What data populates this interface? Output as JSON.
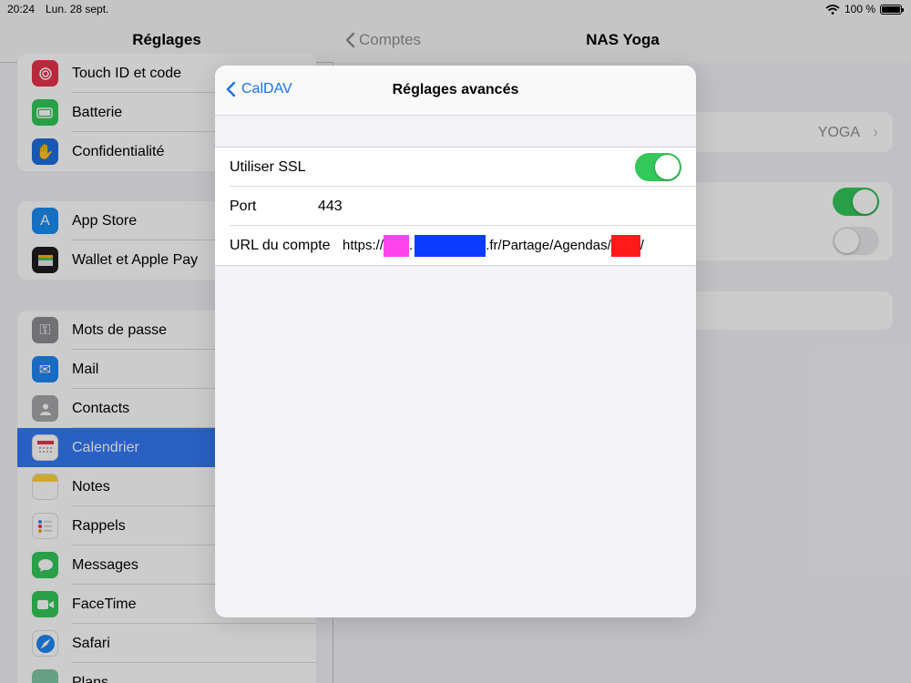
{
  "status": {
    "time": "20:24",
    "date": "Lun. 28 sept.",
    "battery": "100 %"
  },
  "sidebar": {
    "title": "Réglages",
    "group1": [
      {
        "label": "Touch ID et code",
        "icon": "fingerprint-icon",
        "color": "#e5344a"
      },
      {
        "label": "Batterie",
        "icon": "battery-icon",
        "color": "#34c759"
      },
      {
        "label": "Confidentialité",
        "icon": "hand-icon",
        "color": "#1f6fde"
      }
    ],
    "group2": [
      {
        "label": "App Store",
        "icon": "app-store-icon",
        "color": "#1a8cf0"
      },
      {
        "label": "Wallet et Apple Pay",
        "icon": "wallet-icon",
        "color": "#1c1c1e"
      }
    ],
    "group3": [
      {
        "label": "Mots de passe",
        "icon": "key-icon",
        "color": "#8e8e93"
      },
      {
        "label": "Mail",
        "icon": "mail-icon",
        "color": "#1e86f0"
      },
      {
        "label": "Contacts",
        "icon": "contacts-icon",
        "color": "#a7a7ab"
      },
      {
        "label": "Calendrier",
        "icon": "calendar-icon",
        "color": "#ffffff"
      },
      {
        "label": "Notes",
        "icon": "notes-icon",
        "color": "#ffd43b"
      },
      {
        "label": "Rappels",
        "icon": "reminders-icon",
        "color": "#ffffff"
      },
      {
        "label": "Messages",
        "icon": "messages-icon",
        "color": "#34c759"
      },
      {
        "label": "FaceTime",
        "icon": "facetime-icon",
        "color": "#34c759"
      },
      {
        "label": "Safari",
        "icon": "safari-icon",
        "color": "#1e86f0"
      },
      {
        "label": "Plans",
        "icon": "maps-icon",
        "color": "#7fc9a5"
      }
    ]
  },
  "detail": {
    "back_label": "Comptes",
    "title": "NAS Yoga",
    "server_value": "YOGA"
  },
  "modal": {
    "back_label": "CalDAV",
    "title": "Réglages avancés",
    "ssl_label": "Utiliser SSL",
    "ssl_on": true,
    "port_label": "Port",
    "port_value": "443",
    "url_label": "URL du compte",
    "url_prefix": "https://",
    "url_dot": ".",
    "url_mid": ".fr/Partage/Agendas/",
    "url_suffix": "/",
    "redact_colors": [
      "#ff44ee",
      "#0a3cff",
      "#ff1a1a"
    ]
  }
}
